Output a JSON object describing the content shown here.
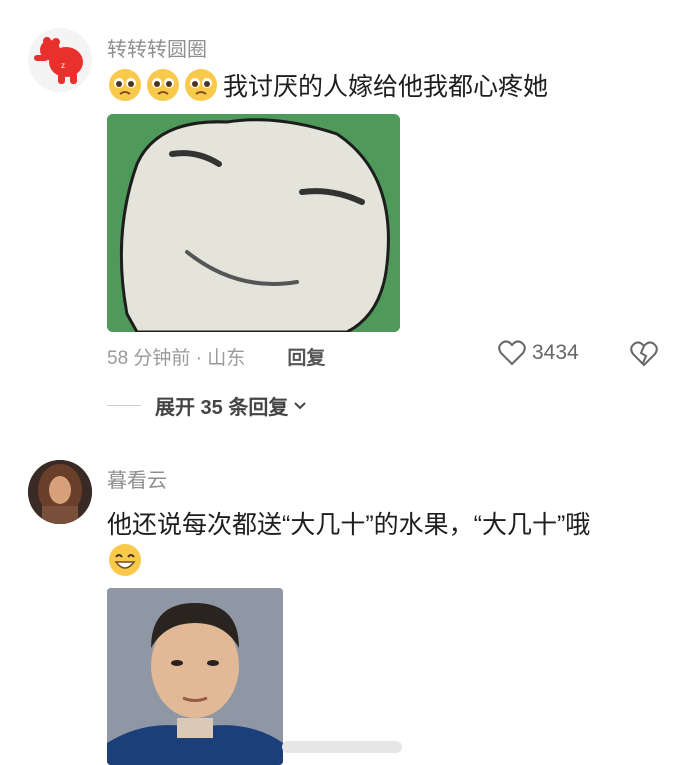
{
  "comments": [
    {
      "username": "转转转圆圈",
      "text": "我讨厌的人嫁给他我都心疼她",
      "emoji_prefix": [
        "pleading-face-icon",
        "pleading-face-icon",
        "pleading-face-icon"
      ],
      "time_location": "58 分钟前 · 山东",
      "reply_label": "回复",
      "like_count": "3434",
      "expand_label": "展开 35 条回复"
    },
    {
      "username": "暮看云",
      "text": "他还说每次都送“大几十”的水果，“大几十”哦",
      "emoji_suffix": "grinning-face-icon"
    }
  ],
  "colors": {
    "username": "#8f8f8f",
    "meta": "#9a9a9a",
    "meme_green": "#4f9a5a",
    "photo_bg": "#8e97a3"
  }
}
